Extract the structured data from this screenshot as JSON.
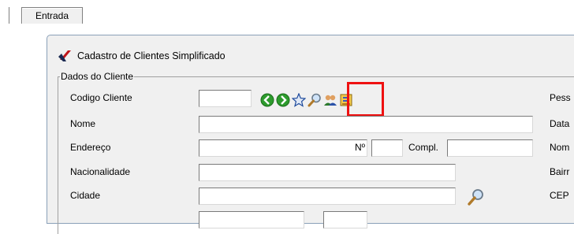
{
  "tabs": [
    {
      "label": "Entrada"
    }
  ],
  "window": {
    "title": "Cadastro de Clientes Simplificado"
  },
  "group": {
    "label": "Dados do Cliente"
  },
  "toolbar": {
    "buttons": [
      "arrow-left-icon",
      "arrow-right-icon",
      "star-icon",
      "search-icon",
      "users-icon",
      "print-icon"
    ],
    "highlighted": "users-icon"
  },
  "form": {
    "codigo_label": "Codigo Cliente",
    "codigo_value": "",
    "nome_label": "Nome",
    "nome_value": "",
    "endereco_label": "Endereço",
    "endereco_value": "",
    "numero_label": "Nº",
    "numero_value": "",
    "compl_label": "Compl.",
    "compl_value": "",
    "nacionalidade_label": "Nacionalidade",
    "nacionalidade_value": "",
    "cidade_label": "Cidade",
    "cidade_value": ""
  },
  "right_labels": [
    "Pess",
    "Data",
    "Nom",
    "Bairr",
    "CEP"
  ],
  "colors": {
    "highlight": "#ee1111",
    "window_border": "#8aa0b8",
    "logo_red": "#c0161c"
  }
}
